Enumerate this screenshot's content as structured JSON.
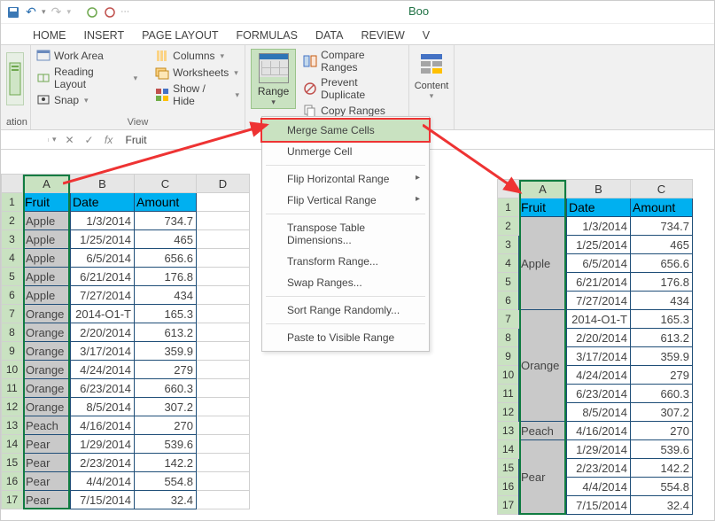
{
  "title_fragment": "Boo",
  "tabs": [
    "HOME",
    "INSERT",
    "PAGE LAYOUT",
    "FORMULAS",
    "DATA",
    "REVIEW",
    "V"
  ],
  "ribbon": {
    "nav_label": "ation",
    "view_group": {
      "items": [
        "Work Area",
        "Reading Layout",
        "Snap"
      ],
      "items2": [
        "Columns",
        "Worksheets",
        "Show / Hide"
      ],
      "label": "View"
    },
    "range_button": "Range",
    "range_sub": [
      "Compare Ranges",
      "Prevent Duplicate",
      "Copy Ranges"
    ],
    "content_button": "Content"
  },
  "dropdown": {
    "items": [
      {
        "label": "Merge Same Cells",
        "hl": true
      },
      {
        "label": "Unmerge Cell"
      },
      {
        "label": "Flip Horizontal Range",
        "sub": true
      },
      {
        "label": "Flip Vertical Range",
        "sub": true
      },
      {
        "label": "Transpose Table Dimensions..."
      },
      {
        "label": "Transform Range..."
      },
      {
        "label": "Swap Ranges..."
      },
      {
        "label": "Sort Range Randomly..."
      },
      {
        "label": "Paste to Visible Range"
      }
    ]
  },
  "formula_bar": {
    "name": "",
    "value": "Fruit"
  },
  "columns": [
    "A",
    "B",
    "C",
    "D"
  ],
  "headers": [
    "Fruit",
    "Date",
    "Amount"
  ],
  "rows": [
    {
      "fruit": "Apple",
      "date": "1/3/2014",
      "amount": "734.7"
    },
    {
      "fruit": "Apple",
      "date": "1/25/2014",
      "amount": "465"
    },
    {
      "fruit": "Apple",
      "date": "6/5/2014",
      "amount": "656.6"
    },
    {
      "fruit": "Apple",
      "date": "6/21/2014",
      "amount": "176.8"
    },
    {
      "fruit": "Apple",
      "date": "7/27/2014",
      "amount": "434"
    },
    {
      "fruit": "Orange",
      "date": "2014-O1-T",
      "amount": "165.3"
    },
    {
      "fruit": "Orange",
      "date": "2/20/2014",
      "amount": "613.2"
    },
    {
      "fruit": "Orange",
      "date": "3/17/2014",
      "amount": "359.9"
    },
    {
      "fruit": "Orange",
      "date": "4/24/2014",
      "amount": "279"
    },
    {
      "fruit": "Orange",
      "date": "6/23/2014",
      "amount": "660.3"
    },
    {
      "fruit": "Orange",
      "date": "8/5/2014",
      "amount": "307.2"
    },
    {
      "fruit": "Peach",
      "date": "4/16/2014",
      "amount": "270"
    },
    {
      "fruit": "Pear",
      "date": "1/29/2014",
      "amount": "539.6"
    },
    {
      "fruit": "Pear",
      "date": "2/23/2014",
      "amount": "142.2"
    },
    {
      "fruit": "Pear",
      "date": "4/4/2014",
      "amount": "554.8"
    },
    {
      "fruit": "Pear",
      "date": "7/15/2014",
      "amount": "32.4"
    }
  ],
  "merged_groups": [
    {
      "label": "Apple",
      "span": 5,
      "dates": [
        "1/3/2014",
        "1/25/2014",
        "6/5/2014",
        "6/21/2014",
        "7/27/2014"
      ],
      "amounts": [
        "734.7",
        "465",
        "656.6",
        "176.8",
        "434"
      ]
    },
    {
      "label": "Orange",
      "span": 6,
      "dates": [
        "2014-O1-T",
        "2/20/2014",
        "3/17/2014",
        "4/24/2014",
        "6/23/2014",
        "8/5/2014"
      ],
      "amounts": [
        "165.3",
        "613.2",
        "359.9",
        "279",
        "660.3",
        "307.2"
      ]
    },
    {
      "label": "Peach",
      "span": 1,
      "dates": [
        "4/16/2014"
      ],
      "amounts": [
        "270"
      ]
    },
    {
      "label": "Pear",
      "span": 4,
      "dates": [
        "1/29/2014",
        "2/23/2014",
        "4/4/2014",
        "7/15/2014"
      ],
      "amounts": [
        "539.6",
        "142.2",
        "554.8",
        "32.4"
      ]
    }
  ]
}
